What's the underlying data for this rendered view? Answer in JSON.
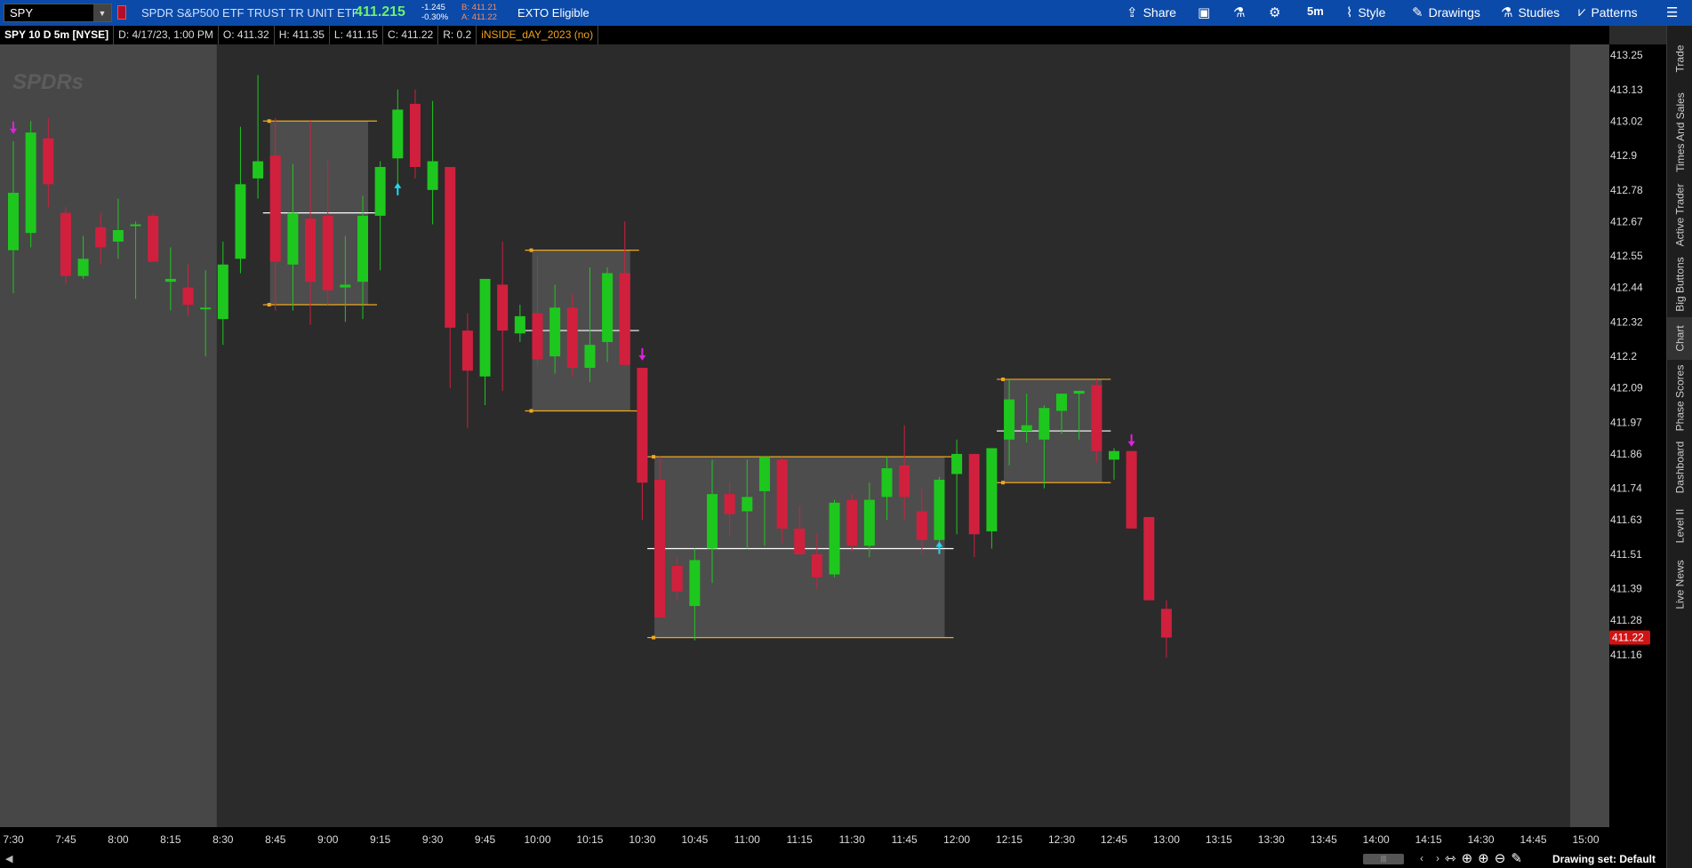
{
  "toolbar": {
    "symbol": "SPY",
    "description": "SPDR S&P500 ETF TRUST TR UNIT ETF",
    "last_price": "411.215",
    "change": "-1.245",
    "change_pct": "-0.30%",
    "bid": "B: 411.21",
    "ask": "A: 411.22",
    "exto": "EXTO Eligible",
    "share_label": "Share",
    "timeframe_label": "5m",
    "style_label": "Style",
    "drawings_label": "Drawings",
    "studies_label": "Studies",
    "patterns_label": "Patterns"
  },
  "infobar": {
    "title": "SPY 10 D 5m [NYSE]",
    "date": "D: 4/17/23, 1:00 PM",
    "open": "O: 411.32",
    "high": "H: 411.35",
    "low": "L: 411.15",
    "close": "C: 411.22",
    "range": "R: 0.2",
    "study": "iNSIDE_dAY_2023 (no)"
  },
  "watermark": "SPDRs",
  "side_tabs": [
    "Trade",
    "Times And Sales",
    "Active Trader",
    "Big Buttons",
    "Chart",
    "Phase Scores",
    "Dashboard",
    "Level II",
    "Live News"
  ],
  "bottom": {
    "drawing_set": "Drawing set: Default"
  },
  "colors": {
    "up": "#1ec71e",
    "down": "#d0203e",
    "box_line": "#f0a81e",
    "arrow_down": "#e020e0",
    "arrow_up": "#20d8f0",
    "price_tag": "#d01414"
  },
  "chart_data": {
    "type": "candlestick",
    "title": "SPY 10 D 5m [NYSE]",
    "x_ticks": [
      "7:30",
      "7:45",
      "8:00",
      "8:15",
      "8:30",
      "8:45",
      "9:00",
      "9:15",
      "9:30",
      "9:45",
      "10:00",
      "10:15",
      "10:30",
      "10:45",
      "11:00",
      "11:15",
      "11:30",
      "11:45",
      "12:00",
      "12:15",
      "12:30",
      "12:45",
      "13:00",
      "13:15",
      "13:30",
      "13:45",
      "14:00",
      "14:15",
      "14:30",
      "14:45",
      "15:00"
    ],
    "y_ticks": [
      "413.25",
      "413.13",
      "413.02",
      "412.9",
      "412.78",
      "412.67",
      "412.55",
      "412.44",
      "412.32",
      "412.2",
      "412.09",
      "411.97",
      "411.86",
      "411.74",
      "411.63",
      "411.51",
      "411.39",
      "411.28",
      "411.16"
    ],
    "current_price_label": "411.22",
    "ylim": [
      411.1,
      413.3
    ],
    "premarket_end": "8:30",
    "candles": [
      {
        "t": "7:30",
        "o": 412.57,
        "h": 412.95,
        "l": 412.42,
        "c": 412.77
      },
      {
        "t": "7:35",
        "o": 412.63,
        "h": 413.02,
        "l": 412.58,
        "c": 412.98
      },
      {
        "t": "7:40",
        "o": 412.96,
        "h": 413.03,
        "l": 412.72,
        "c": 412.8
      },
      {
        "t": "7:45",
        "o": 412.7,
        "h": 412.72,
        "l": 412.45,
        "c": 412.48
      },
      {
        "t": "7:50",
        "o": 412.48,
        "h": 412.62,
        "l": 412.47,
        "c": 412.54
      },
      {
        "t": "7:55",
        "o": 412.65,
        "h": 412.7,
        "l": 412.52,
        "c": 412.58
      },
      {
        "t": "8:00",
        "o": 412.6,
        "h": 412.75,
        "l": 412.54,
        "c": 412.64
      },
      {
        "t": "8:05",
        "o": 412.66,
        "h": 412.67,
        "l": 412.4,
        "c": 412.66
      },
      {
        "t": "8:10",
        "o": 412.69,
        "h": 412.7,
        "l": 412.55,
        "c": 412.53
      },
      {
        "t": "8:15",
        "o": 412.46,
        "h": 412.58,
        "l": 412.36,
        "c": 412.47
      },
      {
        "t": "8:20",
        "o": 412.44,
        "h": 412.52,
        "l": 412.34,
        "c": 412.38
      },
      {
        "t": "8:25",
        "o": 412.37,
        "h": 412.5,
        "l": 412.2,
        "c": 412.37
      },
      {
        "t": "8:30",
        "o": 412.33,
        "h": 412.6,
        "l": 412.24,
        "c": 412.52
      },
      {
        "t": "8:35",
        "o": 412.54,
        "h": 413.0,
        "l": 412.49,
        "c": 412.8
      },
      {
        "t": "8:40",
        "o": 412.82,
        "h": 413.18,
        "l": 412.75,
        "c": 412.88
      },
      {
        "t": "8:45",
        "o": 412.9,
        "h": 413.03,
        "l": 412.36,
        "c": 412.53
      },
      {
        "t": "8:50",
        "o": 412.52,
        "h": 412.87,
        "l": 412.36,
        "c": 412.7
      },
      {
        "t": "8:55",
        "o": 412.68,
        "h": 413.02,
        "l": 412.31,
        "c": 412.46
      },
      {
        "t": "9:00",
        "o": 412.69,
        "h": 412.88,
        "l": 412.38,
        "c": 412.43
      },
      {
        "t": "9:05",
        "o": 412.44,
        "h": 412.62,
        "l": 412.32,
        "c": 412.45
      },
      {
        "t": "9:10",
        "o": 412.46,
        "h": 412.76,
        "l": 412.33,
        "c": 412.69
      },
      {
        "t": "9:15",
        "o": 412.69,
        "h": 412.88,
        "l": 412.5,
        "c": 412.86
      },
      {
        "t": "9:20",
        "o": 412.89,
        "h": 413.13,
        "l": 412.8,
        "c": 413.06
      },
      {
        "t": "9:25",
        "o": 413.08,
        "h": 413.13,
        "l": 412.82,
        "c": 412.86
      },
      {
        "t": "9:30",
        "o": 412.78,
        "h": 413.09,
        "l": 412.66,
        "c": 412.88
      },
      {
        "t": "9:35",
        "o": 412.86,
        "h": 412.86,
        "l": 412.09,
        "c": 412.3
      },
      {
        "t": "9:40",
        "o": 412.29,
        "h": 412.35,
        "l": 411.95,
        "c": 412.15
      },
      {
        "t": "9:45",
        "o": 412.13,
        "h": 412.47,
        "l": 412.03,
        "c": 412.47
      },
      {
        "t": "9:50",
        "o": 412.45,
        "h": 412.6,
        "l": 412.08,
        "c": 412.29
      },
      {
        "t": "9:55",
        "o": 412.28,
        "h": 412.38,
        "l": 412.25,
        "c": 412.34
      },
      {
        "t": "10:00",
        "o": 412.35,
        "h": 412.55,
        "l": 412.17,
        "c": 412.19
      },
      {
        "t": "10:05",
        "o": 412.2,
        "h": 412.45,
        "l": 412.14,
        "c": 412.37
      },
      {
        "t": "10:10",
        "o": 412.37,
        "h": 412.42,
        "l": 412.13,
        "c": 412.16
      },
      {
        "t": "10:15",
        "o": 412.16,
        "h": 412.51,
        "l": 412.11,
        "c": 412.24
      },
      {
        "t": "10:20",
        "o": 412.25,
        "h": 412.51,
        "l": 412.18,
        "c": 412.49
      },
      {
        "t": "10:25",
        "o": 412.49,
        "h": 412.67,
        "l": 412.17,
        "c": 412.17
      },
      {
        "t": "10:30",
        "o": 412.16,
        "h": 412.16,
        "l": 411.63,
        "c": 411.76
      },
      {
        "t": "10:35",
        "o": 411.77,
        "h": 411.85,
        "l": 411.29,
        "c": 411.29
      },
      {
        "t": "10:40",
        "o": 411.47,
        "h": 411.5,
        "l": 411.35,
        "c": 411.38
      },
      {
        "t": "10:45",
        "o": 411.33,
        "h": 411.53,
        "l": 411.21,
        "c": 411.49
      },
      {
        "t": "10:50",
        "o": 411.53,
        "h": 411.84,
        "l": 411.41,
        "c": 411.72
      },
      {
        "t": "10:55",
        "o": 411.72,
        "h": 411.76,
        "l": 411.57,
        "c": 411.65
      },
      {
        "t": "11:00",
        "o": 411.66,
        "h": 411.84,
        "l": 411.53,
        "c": 411.71
      },
      {
        "t": "11:05",
        "o": 411.73,
        "h": 411.85,
        "l": 411.54,
        "c": 411.85
      },
      {
        "t": "11:10",
        "o": 411.84,
        "h": 411.85,
        "l": 411.55,
        "c": 411.6
      },
      {
        "t": "11:15",
        "o": 411.6,
        "h": 411.68,
        "l": 411.52,
        "c": 411.51
      },
      {
        "t": "11:20",
        "o": 411.51,
        "h": 411.58,
        "l": 411.39,
        "c": 411.43
      },
      {
        "t": "11:25",
        "o": 411.44,
        "h": 411.7,
        "l": 411.43,
        "c": 411.69
      },
      {
        "t": "11:30",
        "o": 411.7,
        "h": 411.72,
        "l": 411.52,
        "c": 411.54
      },
      {
        "t": "11:35",
        "o": 411.54,
        "h": 411.76,
        "l": 411.5,
        "c": 411.7
      },
      {
        "t": "11:40",
        "o": 411.71,
        "h": 411.85,
        "l": 411.63,
        "c": 411.81
      },
      {
        "t": "11:45",
        "o": 411.82,
        "h": 411.96,
        "l": 411.63,
        "c": 411.71
      },
      {
        "t": "11:50",
        "o": 411.66,
        "h": 411.74,
        "l": 411.51,
        "c": 411.56
      },
      {
        "t": "11:55",
        "o": 411.56,
        "h": 411.78,
        "l": 411.54,
        "c": 411.77
      },
      {
        "t": "12:00",
        "o": 411.79,
        "h": 411.91,
        "l": 411.58,
        "c": 411.86
      },
      {
        "t": "12:05",
        "o": 411.86,
        "h": 411.86,
        "l": 411.5,
        "c": 411.58
      },
      {
        "t": "12:10",
        "o": 411.59,
        "h": 411.88,
        "l": 411.53,
        "c": 411.88
      },
      {
        "t": "12:15",
        "o": 411.91,
        "h": 412.12,
        "l": 411.82,
        "c": 412.05
      },
      {
        "t": "12:20",
        "o": 411.94,
        "h": 412.07,
        "l": 411.9,
        "c": 411.96
      },
      {
        "t": "12:25",
        "o": 411.91,
        "h": 412.03,
        "l": 411.74,
        "c": 412.02
      },
      {
        "t": "12:30",
        "o": 412.01,
        "h": 412.07,
        "l": 411.93,
        "c": 412.07
      },
      {
        "t": "12:35",
        "o": 412.07,
        "h": 412.08,
        "l": 411.91,
        "c": 412.08
      },
      {
        "t": "12:40",
        "o": 412.1,
        "h": 412.12,
        "l": 411.83,
        "c": 411.87
      },
      {
        "t": "12:45",
        "o": 411.84,
        "h": 411.88,
        "l": 411.77,
        "c": 411.87
      },
      {
        "t": "12:50",
        "o": 411.87,
        "h": 411.87,
        "l": 411.6,
        "c": 411.6
      },
      {
        "t": "12:55",
        "o": 411.64,
        "h": 411.64,
        "l": 411.35,
        "c": 411.35
      },
      {
        "t": "13:00",
        "o": 411.32,
        "h": 411.35,
        "l": 411.15,
        "c": 411.22
      }
    ],
    "inside_day_boxes": [
      {
        "start": "8:45",
        "end": "9:10",
        "high": 413.02,
        "low": 412.38,
        "mid": 412.7
      },
      {
        "start": "10:00",
        "end": "10:25",
        "high": 412.57,
        "low": 412.01,
        "mid": 412.29
      },
      {
        "start": "10:35",
        "end": "11:55",
        "high": 411.85,
        "low": 411.22,
        "mid": 411.53
      },
      {
        "start": "12:15",
        "end": "12:40",
        "high": 412.12,
        "low": 411.76,
        "mid": 411.94
      }
    ],
    "signal_arrows": [
      {
        "t": "7:30",
        "dir": "down",
        "price": 413.0
      },
      {
        "t": "9:20",
        "dir": "up",
        "price": 412.78
      },
      {
        "t": "10:30",
        "dir": "down",
        "price": 412.21
      },
      {
        "t": "11:55",
        "dir": "up",
        "price": 411.53
      },
      {
        "t": "12:50",
        "dir": "down",
        "price": 411.91
      }
    ]
  }
}
